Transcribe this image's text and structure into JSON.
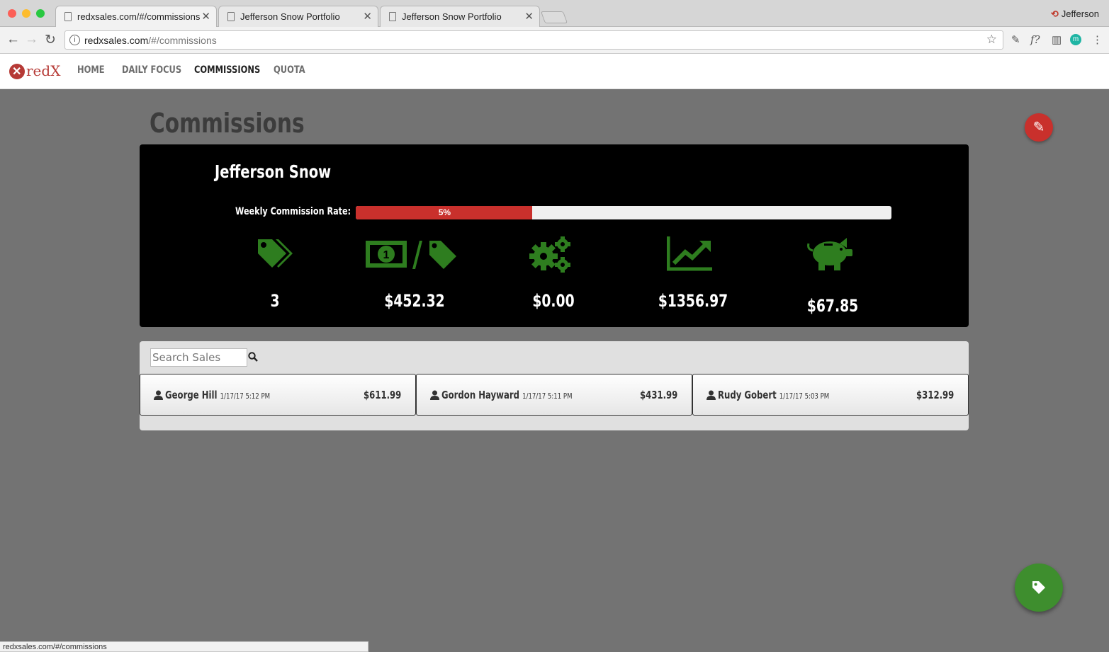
{
  "browser": {
    "tabs": [
      {
        "title": "redxsales.com/#/commissions",
        "active": true
      },
      {
        "title": "Jefferson Snow Portfolio",
        "active": false
      },
      {
        "title": "Jefferson Snow Portfolio",
        "active": false
      }
    ],
    "profile_name": "Jefferson",
    "url_host": "redxsales.com",
    "url_path": "/#/commissions",
    "status_url": "redxsales.com/#/commissions"
  },
  "app": {
    "logo_text": "redX",
    "nav": [
      "HOME",
      "DAILY FOCUS",
      "COMMISSIONS",
      "QUOTA"
    ],
    "active_nav": "COMMISSIONS"
  },
  "page": {
    "title": "Commissions"
  },
  "summary": {
    "rep_name": "Jefferson Snow",
    "rate_label": "Weekly Commission Rate:",
    "rate_text": "5%",
    "rate_fill_fraction": 0.33,
    "stats": [
      {
        "icon": "tags-icon",
        "value": "3"
      },
      {
        "icon": "money-per-tag-icon",
        "value": "$452.32"
      },
      {
        "icon": "gears-icon",
        "value": "$0.00"
      },
      {
        "icon": "line-chart-icon",
        "value": "$1356.97"
      },
      {
        "icon": "piggy-bank-icon",
        "value": "$67.85"
      }
    ],
    "icon_color": "#2e7d1f"
  },
  "sales": {
    "search_placeholder": "Search Sales",
    "items": [
      {
        "name": "George Hill",
        "date": "1/17/17 5:12 PM",
        "amount": "$611.99"
      },
      {
        "name": "Gordon Hayward",
        "date": "1/17/17 5:11 PM",
        "amount": "$431.99"
      },
      {
        "name": "Rudy Gobert",
        "date": "1/17/17 5:03 PM",
        "amount": "$312.99"
      }
    ]
  },
  "colors": {
    "accent_red": "#c9302c",
    "accent_green": "#3e8e2e",
    "page_bg": "#737373"
  }
}
